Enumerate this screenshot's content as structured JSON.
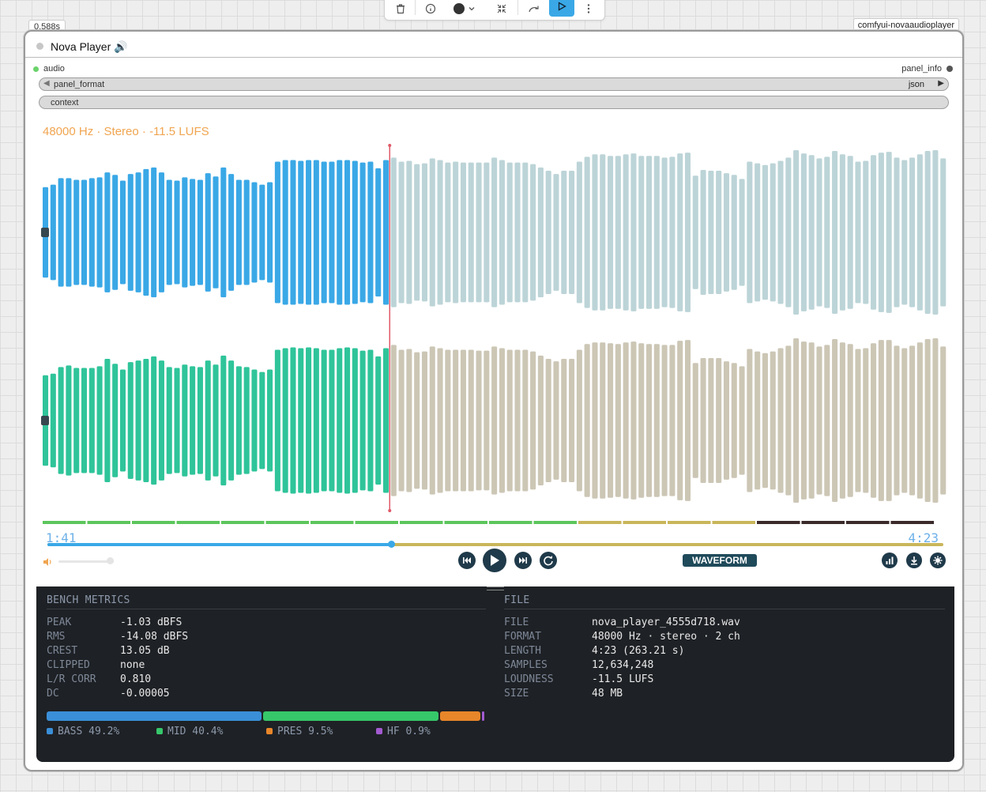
{
  "toolbar": {
    "icons": [
      "trash-icon",
      "info-icon",
      "color-circle-icon",
      "chevron-down-icon",
      "collapse-icon",
      "bypass-icon",
      "run-icon",
      "more-icon"
    ]
  },
  "node": {
    "exec_time": "0.588s",
    "node_id": "comfyui-novaaudioplayer",
    "title": "Nova Player 🔊",
    "input_slot": "audio",
    "output_slot": "panel_info",
    "widget_format_label": "panel_format",
    "widget_format_value": "json",
    "widget_context_label": "context"
  },
  "player": {
    "info_line": "48000 Hz · Stereo  ·  -11.5 LUFS",
    "time_current": "1:41",
    "time_total": "4:23",
    "progress_fraction": 0.3837,
    "mode_label": "WAVEFORM",
    "volume_fraction": 1.0,
    "colors": {
      "left_played": "#3aa8e6",
      "left_unplayed": "#bcd4d7",
      "right_played": "#2fc49a",
      "right_unplayed": "#ccc6b5",
      "playhead": "#e05a6a",
      "accent": "#f0a550"
    },
    "left_channel": [
      0.55,
      0.58,
      0.66,
      0.66,
      0.64,
      0.64,
      0.66,
      0.67,
      0.73,
      0.7,
      0.63,
      0.71,
      0.73,
      0.77,
      0.79,
      0.73,
      0.64,
      0.63,
      0.67,
      0.65,
      0.64,
      0.72,
      0.68,
      0.79,
      0.71,
      0.64,
      0.64,
      0.61,
      0.58,
      0.61,
      0.86,
      0.88,
      0.88,
      0.87,
      0.88,
      0.88,
      0.86,
      0.86,
      0.88,
      0.88,
      0.87,
      0.85,
      0.86,
      0.78,
      0.88,
      0.91,
      0.86,
      0.87,
      0.83,
      0.84,
      0.9,
      0.88,
      0.85,
      0.86,
      0.85,
      0.85,
      0.85,
      0.85,
      0.91,
      0.88,
      0.85,
      0.85,
      0.85,
      0.83,
      0.79,
      0.75,
      0.71,
      0.75,
      0.75,
      0.86,
      0.92,
      0.95,
      0.95,
      0.93,
      0.93,
      0.95,
      0.96,
      0.93,
      0.93,
      0.93,
      0.91,
      0.92,
      0.96,
      0.97,
      0.69,
      0.76,
      0.75,
      0.75,
      0.72,
      0.7,
      0.65,
      0.86,
      0.84,
      0.82,
      0.84,
      0.87,
      0.91,
      1.0,
      0.96,
      0.94,
      0.9,
      0.92,
      0.99,
      0.95,
      0.93,
      0.86,
      0.87,
      0.94,
      0.97,
      0.98,
      0.91,
      0.88,
      0.91,
      0.95,
      0.99,
      1.0,
      0.9
    ],
    "right_channel": [
      0.55,
      0.57,
      0.65,
      0.67,
      0.64,
      0.64,
      0.64,
      0.66,
      0.75,
      0.69,
      0.62,
      0.71,
      0.73,
      0.75,
      0.78,
      0.73,
      0.65,
      0.64,
      0.68,
      0.66,
      0.65,
      0.73,
      0.68,
      0.79,
      0.73,
      0.66,
      0.65,
      0.62,
      0.59,
      0.62,
      0.86,
      0.88,
      0.89,
      0.88,
      0.89,
      0.88,
      0.86,
      0.86,
      0.88,
      0.89,
      0.88,
      0.85,
      0.86,
      0.78,
      0.88,
      0.92,
      0.86,
      0.87,
      0.83,
      0.84,
      0.9,
      0.88,
      0.86,
      0.86,
      0.86,
      0.86,
      0.85,
      0.85,
      0.9,
      0.88,
      0.86,
      0.86,
      0.86,
      0.84,
      0.79,
      0.75,
      0.72,
      0.75,
      0.75,
      0.86,
      0.93,
      0.95,
      0.95,
      0.94,
      0.93,
      0.95,
      0.96,
      0.94,
      0.93,
      0.93,
      0.92,
      0.92,
      0.97,
      0.98,
      0.7,
      0.76,
      0.76,
      0.76,
      0.72,
      0.7,
      0.66,
      0.87,
      0.84,
      0.82,
      0.84,
      0.88,
      0.91,
      1.0,
      0.96,
      0.95,
      0.9,
      0.92,
      0.99,
      0.95,
      0.93,
      0.87,
      0.88,
      0.94,
      0.98,
      0.98,
      0.91,
      0.88,
      0.91,
      0.95,
      0.99,
      1.0,
      0.9
    ],
    "segment_colors": [
      "#5cc65c",
      "#5cc65c",
      "#5cc65c",
      "#5cc65c",
      "#5cc65c",
      "#5cc65c",
      "#5cc65c",
      "#5cc65c",
      "#5cc65c",
      "#5cc65c",
      "#5cc65c",
      "#5cc65c",
      "#c9b65a",
      "#c9b65a",
      "#c9b65a",
      "#c9b65a",
      "#3a2a2a",
      "#3a2a2a",
      "#3a2a2a",
      "#3a2a2a"
    ]
  },
  "bench": {
    "title": "BENCH METRICS",
    "rows": [
      {
        "k": "PEAK",
        "v": "-1.03 dBFS"
      },
      {
        "k": "RMS",
        "v": "-14.08 dBFS"
      },
      {
        "k": "CREST",
        "v": "13.05 dB"
      },
      {
        "k": "CLIPPED",
        "v": "none"
      },
      {
        "k": "L/R CORR",
        "v": "0.810"
      },
      {
        "k": "DC",
        "v": "-0.00005"
      }
    ],
    "bands": [
      {
        "label": "BASS 49.2%",
        "fraction": 0.492,
        "color": "#3a8fd8"
      },
      {
        "label": "MID 40.4%",
        "fraction": 0.404,
        "color": "#36c76a"
      },
      {
        "label": "PRES 9.5%",
        "fraction": 0.095,
        "color": "#e8862a"
      },
      {
        "label": "HF 0.9%",
        "fraction": 0.009,
        "color": "#a35bd1"
      }
    ]
  },
  "file": {
    "title": "FILE",
    "rows": [
      {
        "k": "FILE",
        "v": "nova_player_4555d718.wav"
      },
      {
        "k": "FORMAT",
        "v": "48000 Hz · stereo · 2 ch"
      },
      {
        "k": "LENGTH",
        "v": "4:23 (263.21 s)"
      },
      {
        "k": "SAMPLES",
        "v": "12,634,248"
      },
      {
        "k": "LOUDNESS",
        "v": "-11.5 LUFS"
      },
      {
        "k": "SIZE",
        "v": "48 MB"
      }
    ]
  }
}
